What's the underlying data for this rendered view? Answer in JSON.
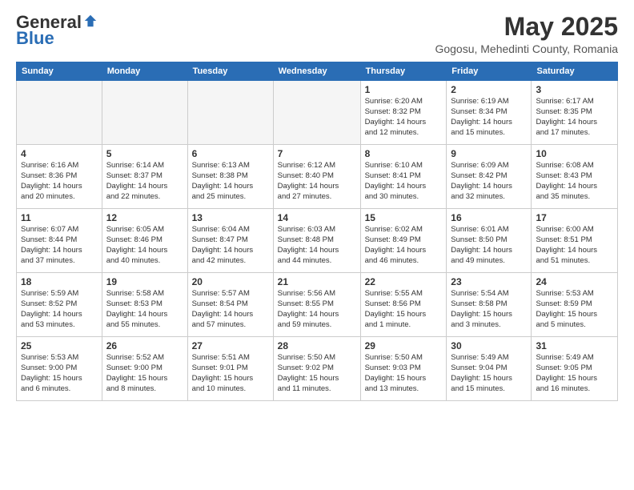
{
  "header": {
    "logo_general": "General",
    "logo_blue": "Blue",
    "month_title": "May 2025",
    "location": "Gogosu, Mehedinti County, Romania"
  },
  "days_of_week": [
    "Sunday",
    "Monday",
    "Tuesday",
    "Wednesday",
    "Thursday",
    "Friday",
    "Saturday"
  ],
  "weeks": [
    [
      {
        "day": "",
        "info": ""
      },
      {
        "day": "",
        "info": ""
      },
      {
        "day": "",
        "info": ""
      },
      {
        "day": "",
        "info": ""
      },
      {
        "day": "1",
        "info": "Sunrise: 6:20 AM\nSunset: 8:32 PM\nDaylight: 14 hours\nand 12 minutes."
      },
      {
        "day": "2",
        "info": "Sunrise: 6:19 AM\nSunset: 8:34 PM\nDaylight: 14 hours\nand 15 minutes."
      },
      {
        "day": "3",
        "info": "Sunrise: 6:17 AM\nSunset: 8:35 PM\nDaylight: 14 hours\nand 17 minutes."
      }
    ],
    [
      {
        "day": "4",
        "info": "Sunrise: 6:16 AM\nSunset: 8:36 PM\nDaylight: 14 hours\nand 20 minutes."
      },
      {
        "day": "5",
        "info": "Sunrise: 6:14 AM\nSunset: 8:37 PM\nDaylight: 14 hours\nand 22 minutes."
      },
      {
        "day": "6",
        "info": "Sunrise: 6:13 AM\nSunset: 8:38 PM\nDaylight: 14 hours\nand 25 minutes."
      },
      {
        "day": "7",
        "info": "Sunrise: 6:12 AM\nSunset: 8:40 PM\nDaylight: 14 hours\nand 27 minutes."
      },
      {
        "day": "8",
        "info": "Sunrise: 6:10 AM\nSunset: 8:41 PM\nDaylight: 14 hours\nand 30 minutes."
      },
      {
        "day": "9",
        "info": "Sunrise: 6:09 AM\nSunset: 8:42 PM\nDaylight: 14 hours\nand 32 minutes."
      },
      {
        "day": "10",
        "info": "Sunrise: 6:08 AM\nSunset: 8:43 PM\nDaylight: 14 hours\nand 35 minutes."
      }
    ],
    [
      {
        "day": "11",
        "info": "Sunrise: 6:07 AM\nSunset: 8:44 PM\nDaylight: 14 hours\nand 37 minutes."
      },
      {
        "day": "12",
        "info": "Sunrise: 6:05 AM\nSunset: 8:46 PM\nDaylight: 14 hours\nand 40 minutes."
      },
      {
        "day": "13",
        "info": "Sunrise: 6:04 AM\nSunset: 8:47 PM\nDaylight: 14 hours\nand 42 minutes."
      },
      {
        "day": "14",
        "info": "Sunrise: 6:03 AM\nSunset: 8:48 PM\nDaylight: 14 hours\nand 44 minutes."
      },
      {
        "day": "15",
        "info": "Sunrise: 6:02 AM\nSunset: 8:49 PM\nDaylight: 14 hours\nand 46 minutes."
      },
      {
        "day": "16",
        "info": "Sunrise: 6:01 AM\nSunset: 8:50 PM\nDaylight: 14 hours\nand 49 minutes."
      },
      {
        "day": "17",
        "info": "Sunrise: 6:00 AM\nSunset: 8:51 PM\nDaylight: 14 hours\nand 51 minutes."
      }
    ],
    [
      {
        "day": "18",
        "info": "Sunrise: 5:59 AM\nSunset: 8:52 PM\nDaylight: 14 hours\nand 53 minutes."
      },
      {
        "day": "19",
        "info": "Sunrise: 5:58 AM\nSunset: 8:53 PM\nDaylight: 14 hours\nand 55 minutes."
      },
      {
        "day": "20",
        "info": "Sunrise: 5:57 AM\nSunset: 8:54 PM\nDaylight: 14 hours\nand 57 minutes."
      },
      {
        "day": "21",
        "info": "Sunrise: 5:56 AM\nSunset: 8:55 PM\nDaylight: 14 hours\nand 59 minutes."
      },
      {
        "day": "22",
        "info": "Sunrise: 5:55 AM\nSunset: 8:56 PM\nDaylight: 15 hours\nand 1 minute."
      },
      {
        "day": "23",
        "info": "Sunrise: 5:54 AM\nSunset: 8:58 PM\nDaylight: 15 hours\nand 3 minutes."
      },
      {
        "day": "24",
        "info": "Sunrise: 5:53 AM\nSunset: 8:59 PM\nDaylight: 15 hours\nand 5 minutes."
      }
    ],
    [
      {
        "day": "25",
        "info": "Sunrise: 5:53 AM\nSunset: 9:00 PM\nDaylight: 15 hours\nand 6 minutes."
      },
      {
        "day": "26",
        "info": "Sunrise: 5:52 AM\nSunset: 9:00 PM\nDaylight: 15 hours\nand 8 minutes."
      },
      {
        "day": "27",
        "info": "Sunrise: 5:51 AM\nSunset: 9:01 PM\nDaylight: 15 hours\nand 10 minutes."
      },
      {
        "day": "28",
        "info": "Sunrise: 5:50 AM\nSunset: 9:02 PM\nDaylight: 15 hours\nand 11 minutes."
      },
      {
        "day": "29",
        "info": "Sunrise: 5:50 AM\nSunset: 9:03 PM\nDaylight: 15 hours\nand 13 minutes."
      },
      {
        "day": "30",
        "info": "Sunrise: 5:49 AM\nSunset: 9:04 PM\nDaylight: 15 hours\nand 15 minutes."
      },
      {
        "day": "31",
        "info": "Sunrise: 5:49 AM\nSunset: 9:05 PM\nDaylight: 15 hours\nand 16 minutes."
      }
    ]
  ]
}
